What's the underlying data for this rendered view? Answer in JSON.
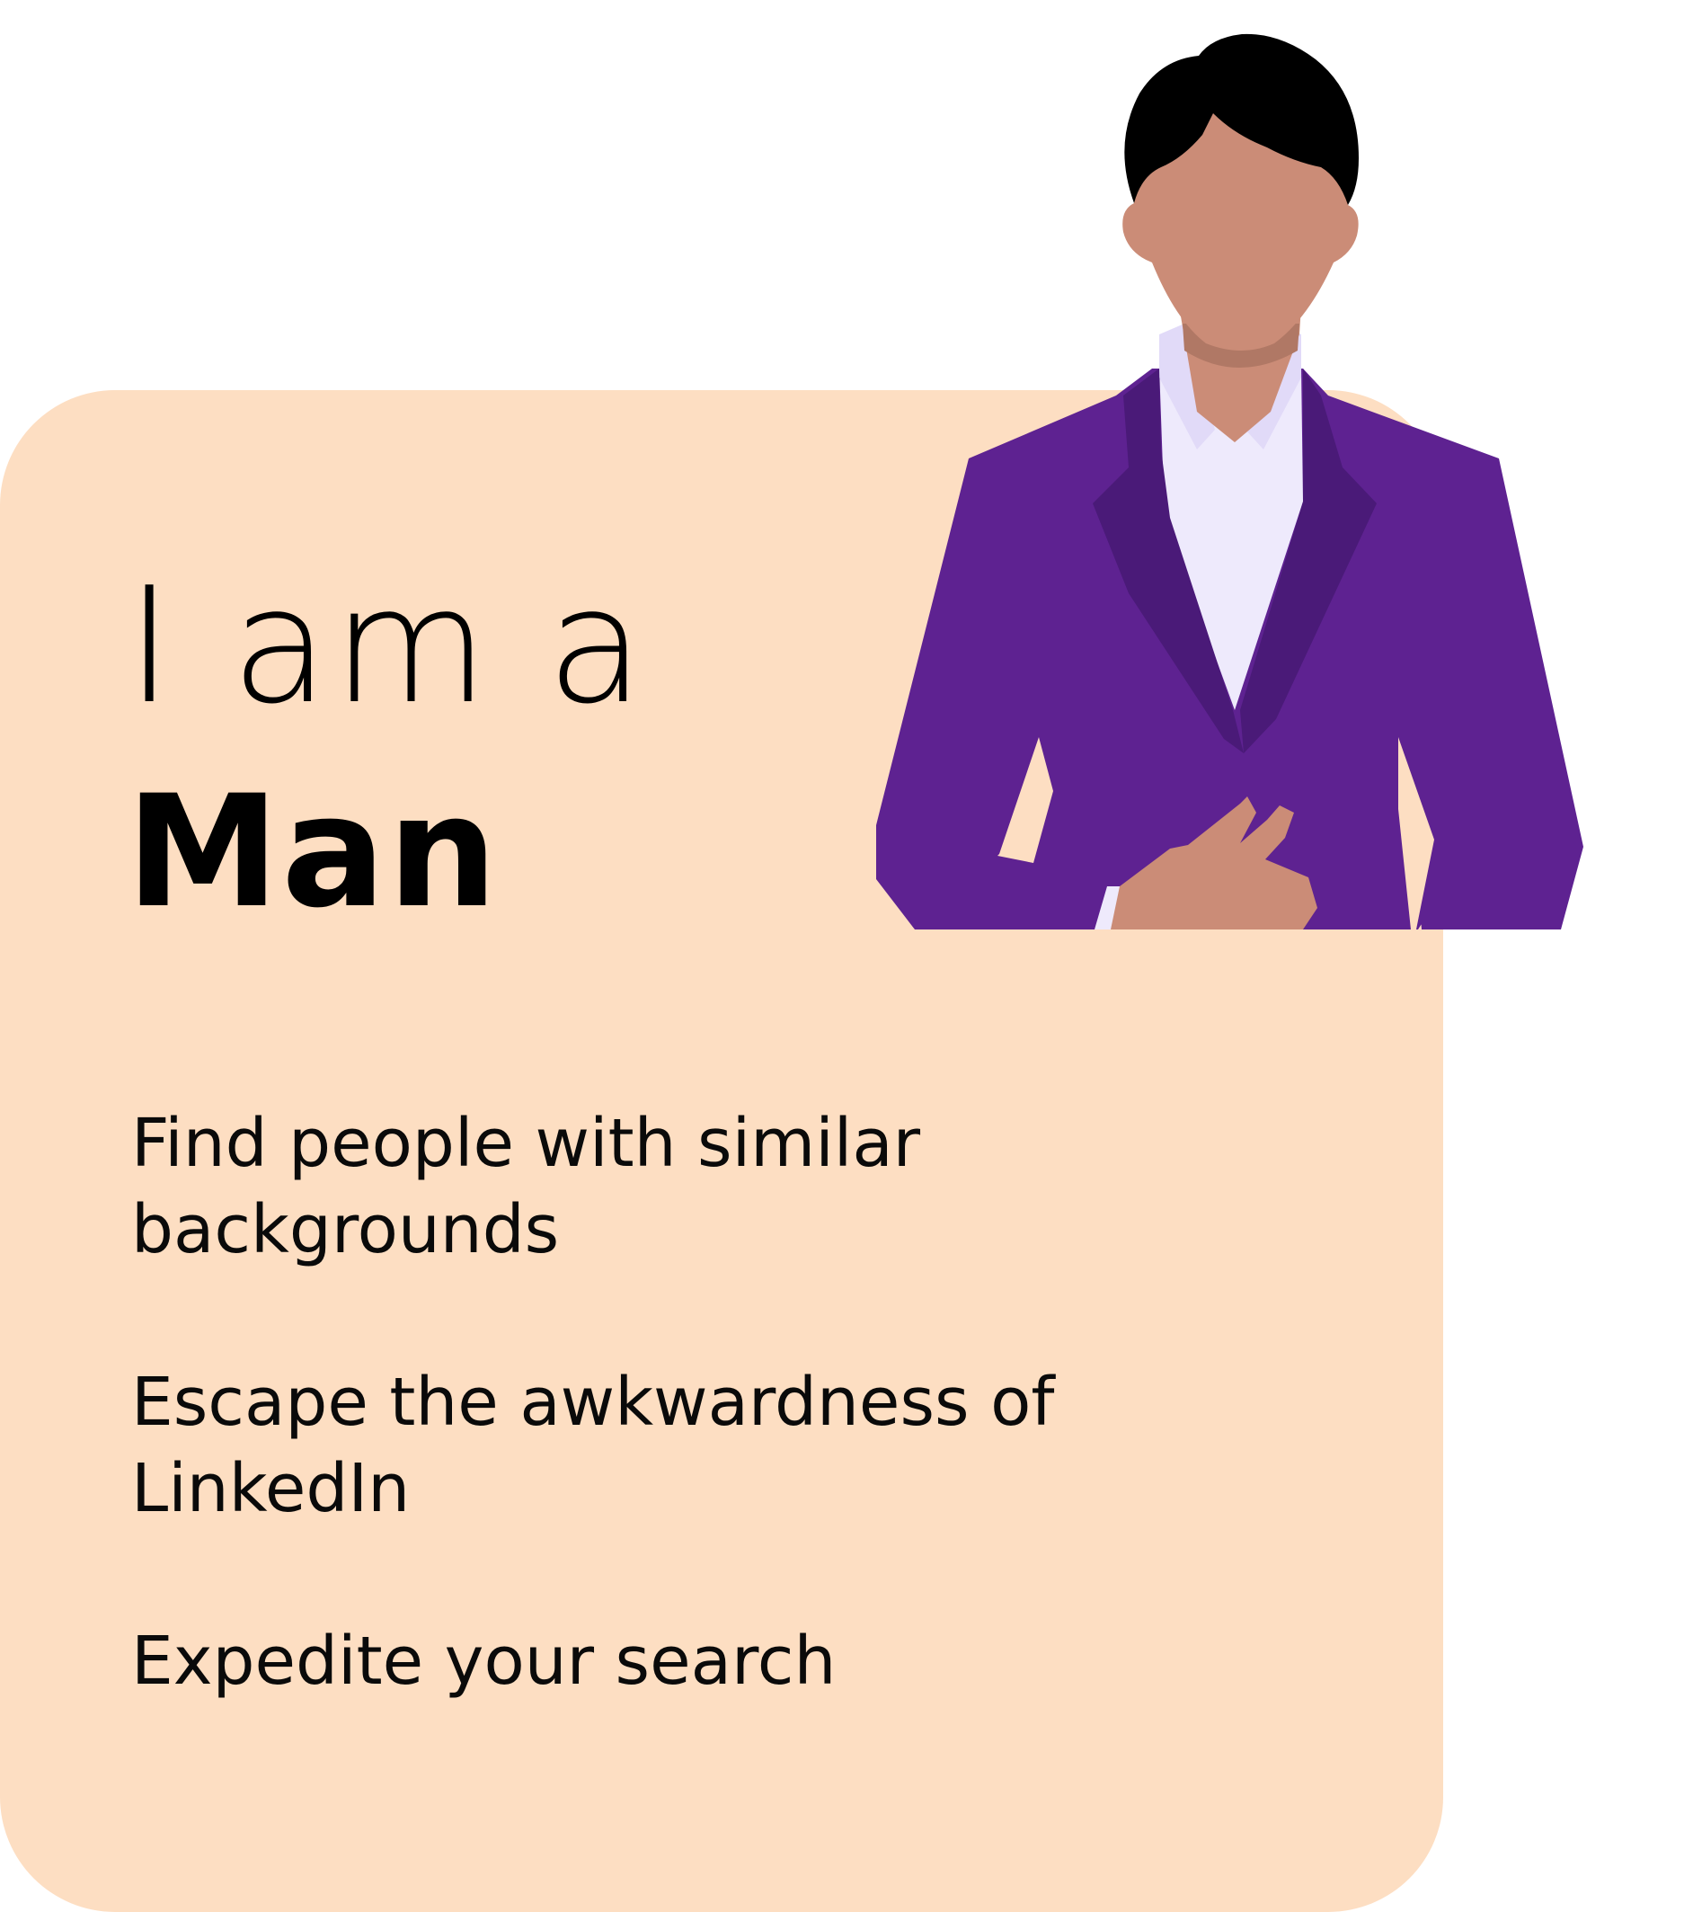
{
  "colors": {
    "card_background": "#FDDEC2",
    "page_background": "#FFFFFF",
    "text": "#000000",
    "jacket": "#5E2291",
    "lapel": "#4A1A78",
    "shirt": "#EEEAFC",
    "collar": "#E1DAF8",
    "skin": "#CB8C77",
    "skin_shadow": "#B07865",
    "hair": "#000000"
  },
  "heading": {
    "intro": "I am a",
    "identity": "Man"
  },
  "benefits": [
    {
      "text": "Find people with similar backgrounds"
    },
    {
      "text": "Escape the awkwardness of LinkedIn"
    },
    {
      "text": "Expedite your search"
    }
  ],
  "illustration": {
    "icon": "man-in-purple-suit-icon"
  }
}
